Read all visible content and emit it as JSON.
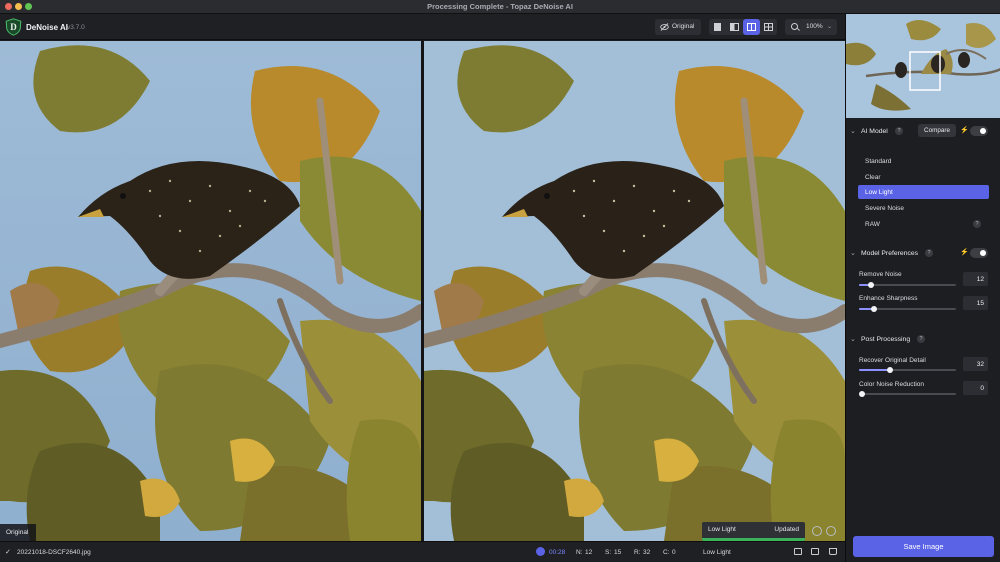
{
  "window": {
    "title": "Processing Complete - Topaz DeNoise AI"
  },
  "toolbar": {
    "app_name": "DeNoise AI",
    "version": "v3.7.0",
    "original_label": "Original",
    "zoom_label": "100%",
    "view_modes": [
      "single-view",
      "split-view",
      "side-by-side-view",
      "grid-view"
    ],
    "active_view_mode": "side-by-side-view"
  },
  "preview": {
    "original_tag": "Original",
    "status_model": "Low Light",
    "status_state": "Updated",
    "progress": 1.0
  },
  "bottom_bar": {
    "filename": "20221018-DSCF2640.jpg",
    "time": "00:28",
    "stats": [
      {
        "key": "N:",
        "value": "12"
      },
      {
        "key": "S:",
        "value": "15"
      },
      {
        "key": "R:",
        "value": "32"
      },
      {
        "key": "C:",
        "value": "0"
      }
    ],
    "model": "Low Light"
  },
  "panel": {
    "ai_model": {
      "title": "AI Model",
      "compare_label": "Compare",
      "models": [
        "Standard",
        "Clear",
        "Low Light",
        "Severe Noise",
        "RAW"
      ],
      "selected": "Low Light"
    },
    "model_preferences": {
      "title": "Model Preferences",
      "sliders": [
        {
          "label": "Remove Noise",
          "value": "12",
          "fraction": 0.12
        },
        {
          "label": "Enhance Sharpness",
          "value": "15",
          "fraction": 0.15
        }
      ]
    },
    "post_processing": {
      "title": "Post Processing",
      "sliders": [
        {
          "label": "Recover Original Detail",
          "value": "32",
          "fraction": 0.32
        },
        {
          "label": "Color Noise Reduction",
          "value": "0",
          "fraction": 0.0
        }
      ]
    },
    "save_label": "Save Image"
  },
  "colors": {
    "accent": "#5a63e6",
    "progress_green": "#3cb35b",
    "sky": "#a3bfd8",
    "leaf_green": "#7a7a2e",
    "leaf_gold": "#c4912f"
  },
  "icons": {
    "help": "?",
    "check": "✓",
    "bolt": "⚡",
    "chevron": "⌄"
  }
}
